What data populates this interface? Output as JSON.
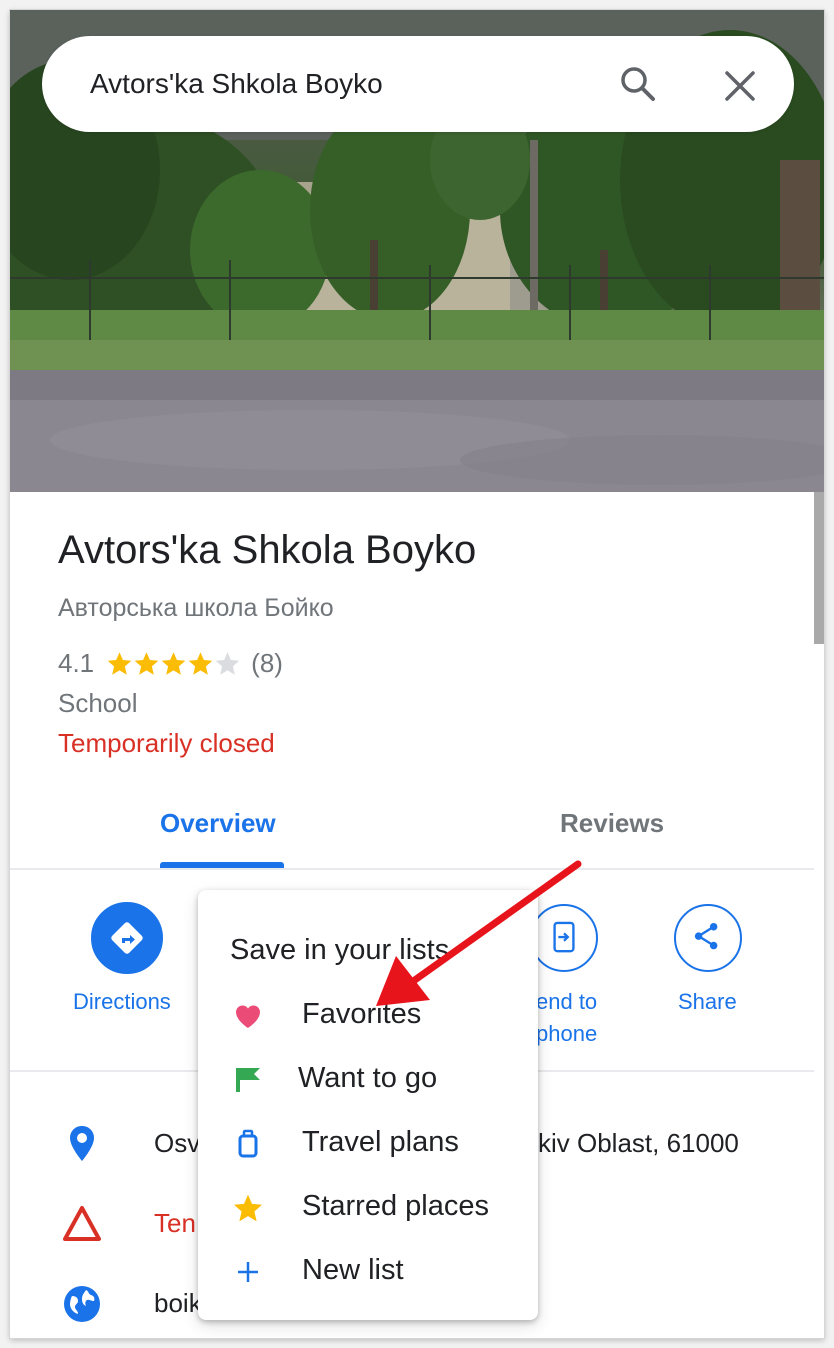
{
  "search": {
    "query": "Avtors'ka Shkola Boyko"
  },
  "place": {
    "title": "Avtors'ka Shkola Boyko",
    "subtitle": "Авторська школа Бойко",
    "rating": "4.1",
    "rating_value": 4.1,
    "stars_filled": 4,
    "stars_total": 5,
    "review_count": "(8)",
    "category": "School",
    "status": "Temporarily closed"
  },
  "tabs": [
    {
      "label": "Overview",
      "active": true
    },
    {
      "label": "Reviews",
      "active": false
    }
  ],
  "actions": {
    "directions": "Directions",
    "send_line1": "end to",
    "send_line2": "phone",
    "share": "Share"
  },
  "details": {
    "address_left": "Osv",
    "address_right": "kiv Oblast, 61000",
    "status_left": "Ten",
    "website_left": "boik"
  },
  "popup": {
    "title": "Save in your lists",
    "items": [
      {
        "label": "Favorites",
        "icon": "heart-icon",
        "color": "#ea4c77"
      },
      {
        "label": "Want to go",
        "icon": "flag-icon",
        "color": "#34a853"
      },
      {
        "label": "Travel plans",
        "icon": "suitcase-icon",
        "color": "#1a73e8"
      },
      {
        "label": "Starred places",
        "icon": "star-icon",
        "color": "#fbbc04"
      },
      {
        "label": "New list",
        "icon": "plus-icon",
        "color": "#1a73e8"
      }
    ]
  },
  "colors": {
    "accent": "#1a73e8",
    "closed": "#d93025",
    "star": "#fbbc04",
    "annotation_arrow": "#e8141c"
  }
}
